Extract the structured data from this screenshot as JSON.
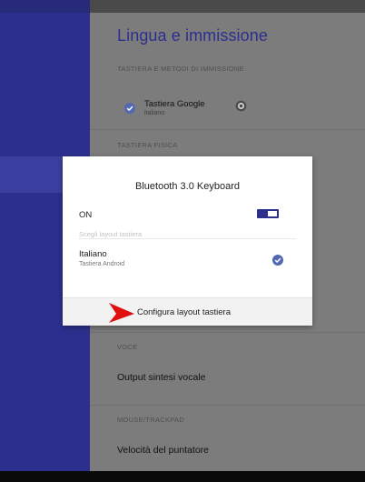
{
  "settings": {
    "title": "Lingua e immissione",
    "section_keyboards": "TASTIERA E METODI DI IMMISSIONE",
    "keyboard_name": "Tastiera Google",
    "keyboard_language": "italiano",
    "section_physical": "TASTIERA FISICA",
    "section_voice": "VOCE",
    "tts_label": "Output sintesi vocale",
    "section_mouse": "MOUSE/TRACKPAD",
    "pointer_speed_label": "Velocità del puntatore"
  },
  "dialog": {
    "title": "Bluetooth 3.0 Keyboard",
    "switch_label": "ON",
    "switch_on": true,
    "layout_hint": "Scegli layout tastiera",
    "layout_name": "Italiano",
    "layout_source": "Tastiera Android",
    "configure_label": "Configura layout tastiera"
  },
  "icons": {
    "keyboard_check": "check-circle-icon",
    "gear": "gear-icon",
    "layout_check": "check-circle-icon",
    "annotation": "red-arrow-icon"
  },
  "colors": {
    "accent": "#2d2f8e",
    "check": "#5268b3",
    "annotation_arrow": "#e01010"
  }
}
